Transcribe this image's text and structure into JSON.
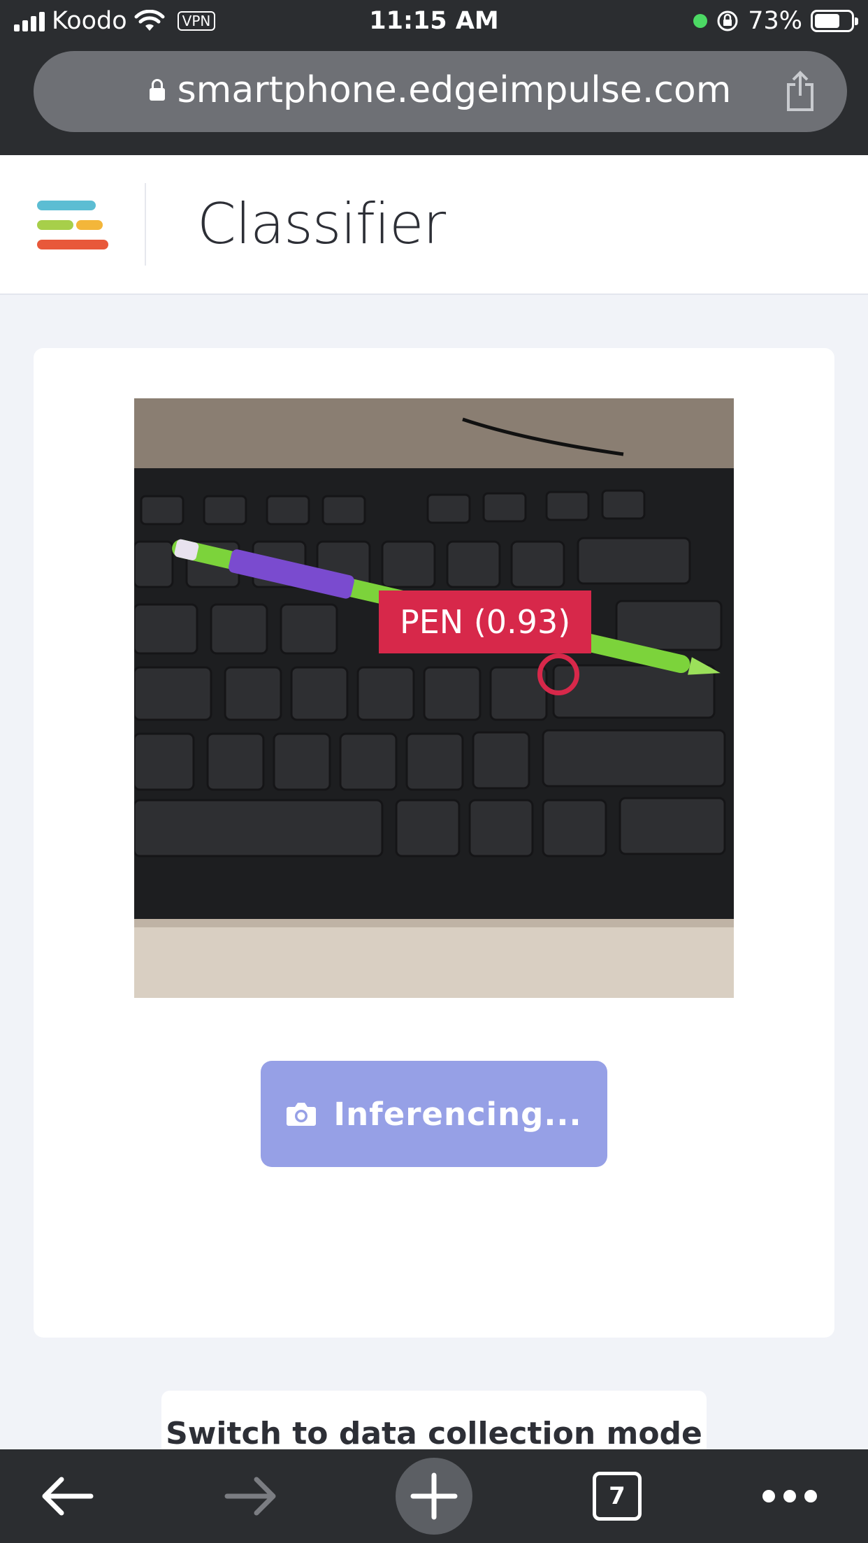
{
  "status_bar": {
    "carrier": "Koodo",
    "vpn": "VPN",
    "time": "11:15 AM",
    "battery": "73%",
    "battery_level": 0.73
  },
  "url_bar": {
    "url": "smartphone.edgeimpulse.com",
    "secure_icon": "lock-icon",
    "share_icon": "share-icon"
  },
  "header": {
    "title": "Classifier",
    "logo_colors": [
      "#5cbdd3",
      "#a7cf4a",
      "#f3b63a",
      "#e8583a"
    ]
  },
  "classifier": {
    "prediction_label": "PEN (0.93)",
    "label_color": "#d7284a",
    "button_label": "Inferencing...",
    "button_icon": "camera-icon",
    "button_color": "#96a0e6"
  },
  "secondary": {
    "switch_label": "Switch to data collection mode"
  },
  "toolbar": {
    "back_icon": "back-arrow-icon",
    "forward_icon": "forward-arrow-icon",
    "new_tab_icon": "plus-icon",
    "tab_count": "7",
    "more_icon": "more-icon"
  }
}
